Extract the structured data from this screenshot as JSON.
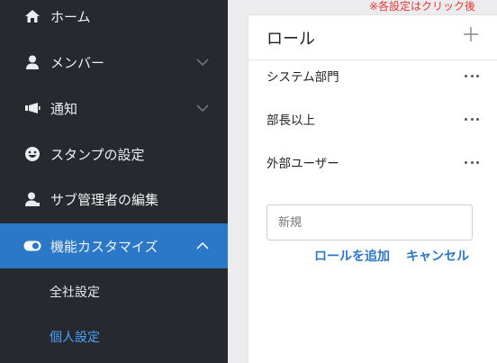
{
  "sidebar": {
    "items": [
      {
        "label": "ホーム",
        "icon": "home-icon"
      },
      {
        "label": "メンバー",
        "icon": "user-icon"
      },
      {
        "label": "通知",
        "icon": "megaphone-icon"
      },
      {
        "label": "スタンプの設定",
        "icon": "smiley-icon"
      },
      {
        "label": "サブ管理者の編集",
        "icon": "admin-user-icon"
      },
      {
        "label": "機能カスタマイズ",
        "icon": "toggle-icon"
      }
    ],
    "sub_items": [
      {
        "label": "全社設定"
      },
      {
        "label": "個人設定"
      }
    ],
    "active_color": "#2b77c8"
  },
  "notice": "※各設定はクリック後",
  "panel": {
    "title": "ロール",
    "roles": [
      {
        "label": "システム部門"
      },
      {
        "label": "部長以上"
      },
      {
        "label": "外部ユーザー"
      }
    ],
    "new_role_placeholder": "新規",
    "add_label": "ロールを追加",
    "cancel_label": "キャンセル"
  }
}
